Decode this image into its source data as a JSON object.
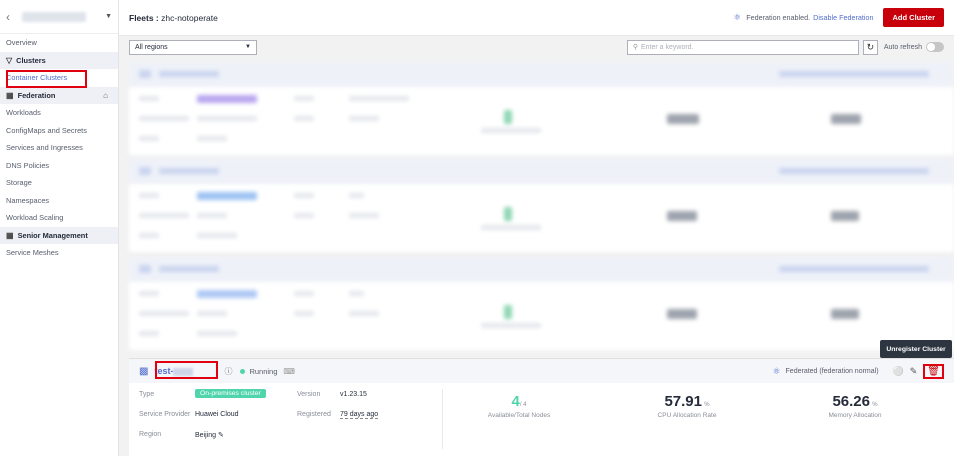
{
  "sidebar": {
    "items": [
      {
        "label": "Overview",
        "kind": "item"
      },
      {
        "label": "Clusters",
        "kind": "group",
        "icon": "filter-icon"
      },
      {
        "label": "Container Clusters",
        "kind": "active"
      },
      {
        "label": "Federation",
        "kind": "group",
        "icon": "grid-icon",
        "extra": "lock-icon"
      },
      {
        "label": "Workloads",
        "kind": "item"
      },
      {
        "label": "ConfigMaps and Secrets",
        "kind": "item"
      },
      {
        "label": "Services and Ingresses",
        "kind": "item"
      },
      {
        "label": "DNS Policies",
        "kind": "item"
      },
      {
        "label": "Storage",
        "kind": "item"
      },
      {
        "label": "Namespaces",
        "kind": "item"
      },
      {
        "label": "Workload Scaling",
        "kind": "item"
      },
      {
        "label": "Senior Management",
        "kind": "group",
        "icon": "grid-icon"
      },
      {
        "label": "Service Meshes",
        "kind": "item"
      }
    ]
  },
  "header": {
    "title_prefix": "Fleets :",
    "fleet_name": "zhc-notoperate",
    "federation_status": "Federation enabled.",
    "disable_link": "Disable Federation",
    "add_cluster": "Add Cluster"
  },
  "toolbar": {
    "region_select": "All regions",
    "search_placeholder": "Enter a keyword.",
    "auto_refresh": "Auto refresh"
  },
  "cluster": {
    "name": "test-",
    "status": "Running",
    "federation": "Federated (federation normal)",
    "tooltip": "Unregister Cluster",
    "type_label": "Type",
    "type_value": "On-premises cluster",
    "provider_label": "Service Provider",
    "provider_value": "Huawei Cloud",
    "region_label": "Region",
    "region_value": "Beijing",
    "version_label": "Version",
    "version_value": "v1.23.15",
    "registered_label": "Registered",
    "registered_value": "79 days ago",
    "nodes_value": "4",
    "nodes_total": "/ 4",
    "nodes_label": "Available/Total Nodes",
    "cpu_value": "57.91",
    "cpu_unit": "%",
    "cpu_label": "CPU Allocation Rate",
    "mem_value": "56.26",
    "mem_unit": "%",
    "mem_label": "Memory Allocation"
  },
  "colors": {
    "accent": "#526ecc",
    "danger": "#c7000b",
    "running": "#50d4ab"
  }
}
